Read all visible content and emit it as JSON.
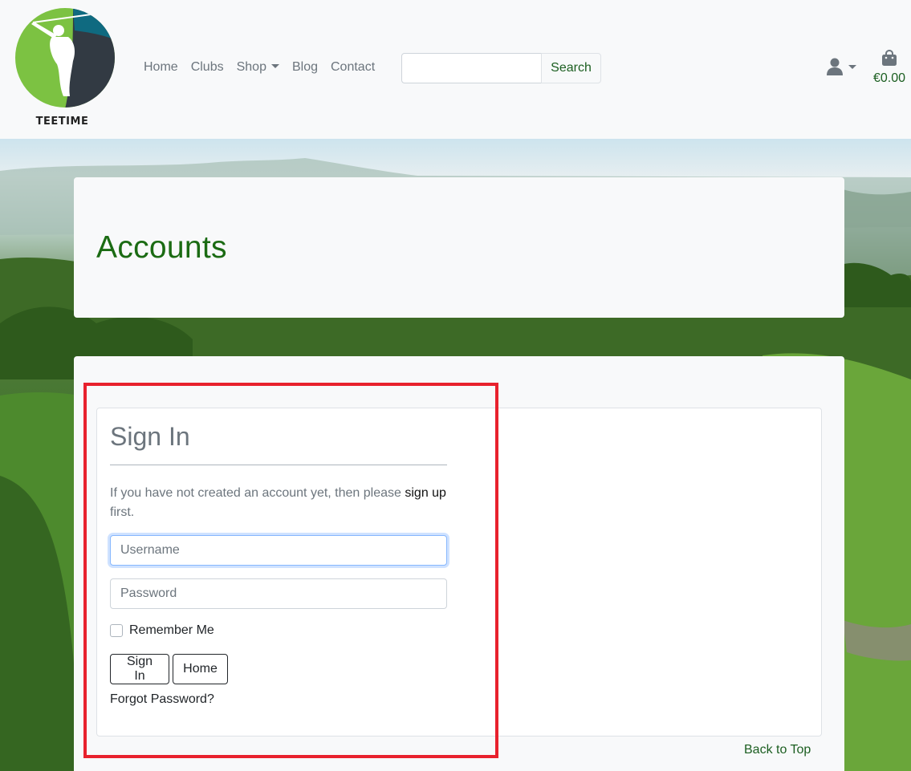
{
  "brand": {
    "name": "TEETIME",
    "colors": {
      "green": "#7cc242",
      "teal": "#0f6a80",
      "dark": "#323a43"
    }
  },
  "nav": {
    "items": [
      {
        "label": "Home"
      },
      {
        "label": "Clubs"
      },
      {
        "label": "Shop",
        "has_dropdown": true
      },
      {
        "label": "Blog"
      },
      {
        "label": "Contact"
      }
    ]
  },
  "search": {
    "value": "",
    "button_label": "Search"
  },
  "account": {
    "icon": "user-icon"
  },
  "cart": {
    "icon": "shopping-bag-icon",
    "total": "€0.00"
  },
  "page": {
    "title": "Accounts"
  },
  "signin": {
    "heading": "Sign In",
    "intro_prefix": "If you have not created an account yet, then please ",
    "signup_link": "sign up",
    "intro_suffix": " first.",
    "username_placeholder": "Username",
    "password_placeholder": "Password",
    "remember_label": "Remember Me",
    "signin_button": "Sign In",
    "home_button": "Home",
    "forgot_link": "Forgot Password?"
  },
  "footer": {
    "back_to_top": "Back to Top"
  },
  "colors": {
    "accent_green": "#1b6b13",
    "highlight": "#e8212d"
  }
}
